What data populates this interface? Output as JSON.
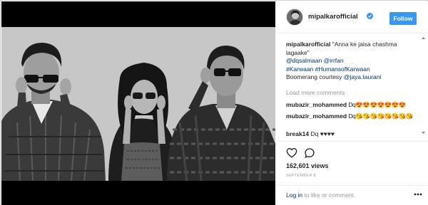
{
  "header": {
    "username": "mipalkarofficial",
    "follow_label": "Follow"
  },
  "caption": {
    "username": "mipalkarofficial",
    "quote": "\"Anna ke jaisa chashma lagaake\"",
    "mention_1": "@dqsalmaan",
    "mention_2": "@irrfan",
    "hashtag_1": "#Karwaan",
    "hashtag_2": "#HumansofKarwaan",
    "credit_prefix": "Boomerang courtesy",
    "credit_mention": "@jaya.taurani"
  },
  "load_more_label": "Load more comments",
  "comments": [
    {
      "username": "mubazir_mohammed",
      "text": "Dq😍😍😍😍😍😍😍"
    },
    {
      "username": "mubazir_mohammed",
      "text": "Dq😘😘😘😘😘😘😘😘"
    },
    {
      "username": "break14",
      "text": "Dq ♥♥♥♥"
    }
  ],
  "stats": {
    "views": "162,601 views",
    "date": "SEPTEMBER 8"
  },
  "login": {
    "link": "Log in",
    "suffix": " to like or comment."
  },
  "icons": {
    "verified": "verified-badge-icon",
    "like": "heart-icon",
    "comment": "comment-icon",
    "more": "more-options-icon"
  },
  "colors": {
    "accent": "#3897f0",
    "link": "#003569",
    "muted": "#999999"
  }
}
